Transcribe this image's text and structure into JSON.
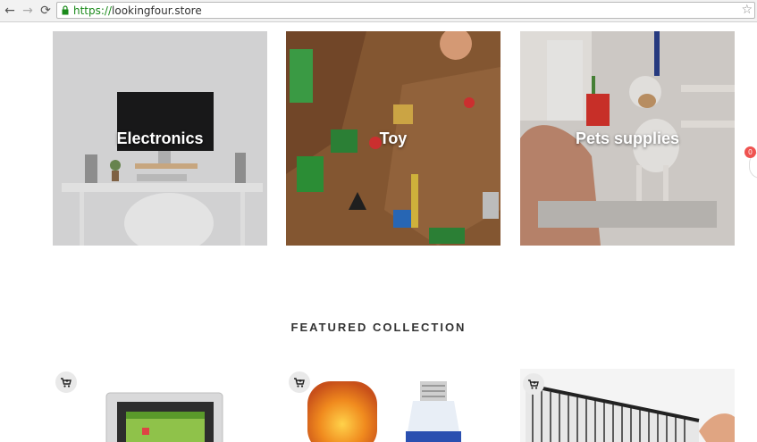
{
  "browser": {
    "url_scheme": "https://",
    "url_host": "lookingfour.store",
    "back_icon": "←",
    "forward_icon": "→",
    "reload_icon": "⟳",
    "star_icon": "☆"
  },
  "categories": [
    {
      "label": "Electronics"
    },
    {
      "label": "Toy"
    },
    {
      "label": "Pets supplies"
    }
  ],
  "featured": {
    "heading": "FEATURED COLLECTION"
  },
  "badge": {
    "count": "0"
  },
  "colors": {
    "accent_badge": "#ef5350",
    "url_green": "#1a8a1a"
  }
}
